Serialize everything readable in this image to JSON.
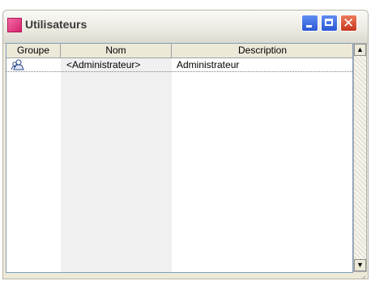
{
  "window": {
    "title": "Utilisateurs",
    "colors": {
      "icon": "#e0357e",
      "close": "#d9542e",
      "titlebar_btn": "#3a6ee6"
    }
  },
  "titlebar_buttons": {
    "minimize_icon": "minimize-icon",
    "maximize_icon": "maximize-icon",
    "close_glyph": "✕"
  },
  "list": {
    "columns": [
      {
        "label": "Groupe"
      },
      {
        "label": "Nom"
      },
      {
        "label": "Description"
      }
    ],
    "rows": [
      {
        "icon": "user-group-icon",
        "name": "<Administrateur>",
        "description": "Administrateur"
      }
    ]
  },
  "toolbar": {
    "buttons": [
      {
        "icon": "import-icon"
      },
      {
        "icon": "export-icon"
      },
      {
        "icon": "properties-icon"
      }
    ]
  },
  "scroll": {
    "left_arrow": "◀",
    "right_arrow": "▶",
    "up_arrow": "▲",
    "down_arrow": "▼"
  }
}
